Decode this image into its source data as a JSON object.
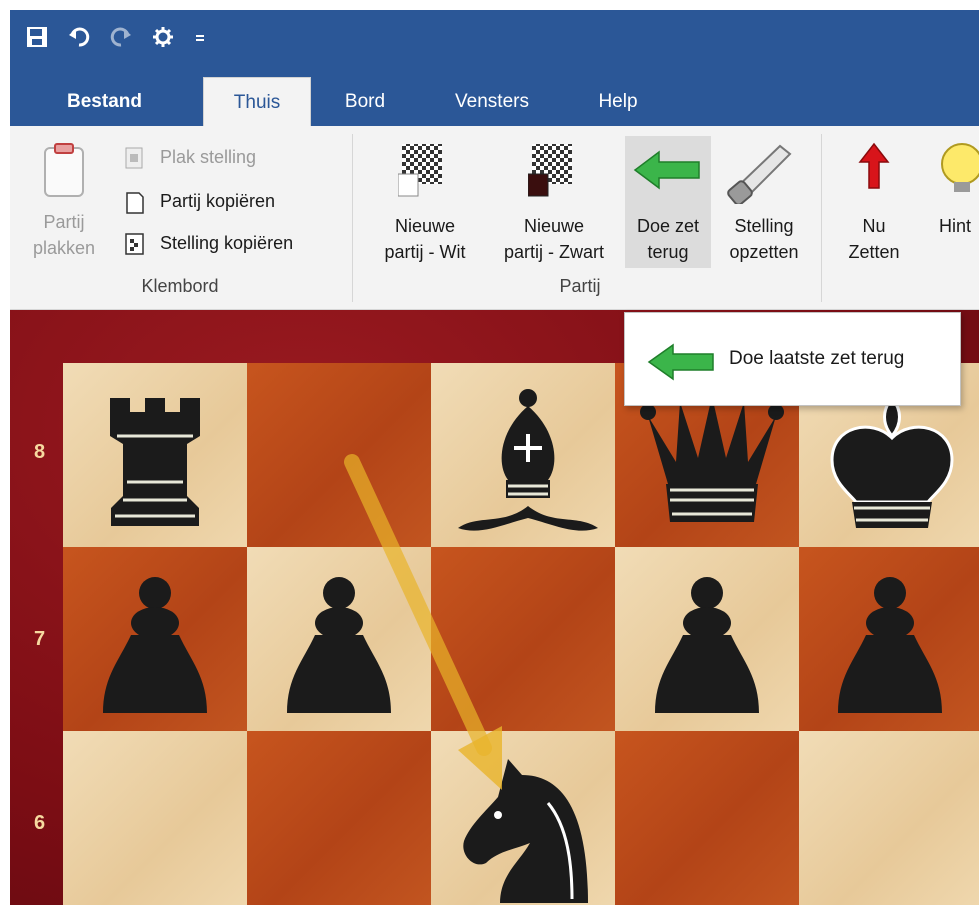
{
  "qat": {
    "icons": [
      "save-icon",
      "undo-icon",
      "redo-icon",
      "engine-icon",
      "customize-icon"
    ]
  },
  "tabs": [
    {
      "label": "Bestand"
    },
    {
      "label": "Thuis"
    },
    {
      "label": "Bord"
    },
    {
      "label": "Vensters"
    },
    {
      "label": "Help"
    }
  ],
  "ribbon": {
    "klembord": {
      "paste_label_1": "Partij",
      "paste_label_2": "plakken",
      "plak_stelling": "Plak stelling",
      "partij_kopieren": "Partij kopiëren",
      "stelling_kopieren": "Stelling kopiëren",
      "group": "Klembord"
    },
    "partij": {
      "new_white_1": "Nieuwe",
      "new_white_2": "partij - Wit",
      "new_black_1": "Nieuwe",
      "new_black_2": "partij - Zwart",
      "undo_1": "Doe zet",
      "undo_2": "terug",
      "setup_1": "Stelling",
      "setup_2": "opzetten",
      "group": "Partij"
    },
    "extra": {
      "move_now_1": "Nu",
      "move_now_2": "Zetten",
      "hint_1": "Hint"
    }
  },
  "tooltip": {
    "text": "Doe laatste zet terug"
  },
  "board": {
    "ranks": [
      "8",
      "7",
      "6"
    ]
  },
  "colors": {
    "ribbon_blue": "#2b5797",
    "arrow": "#e8b42a",
    "frame": "#7c0d14"
  }
}
